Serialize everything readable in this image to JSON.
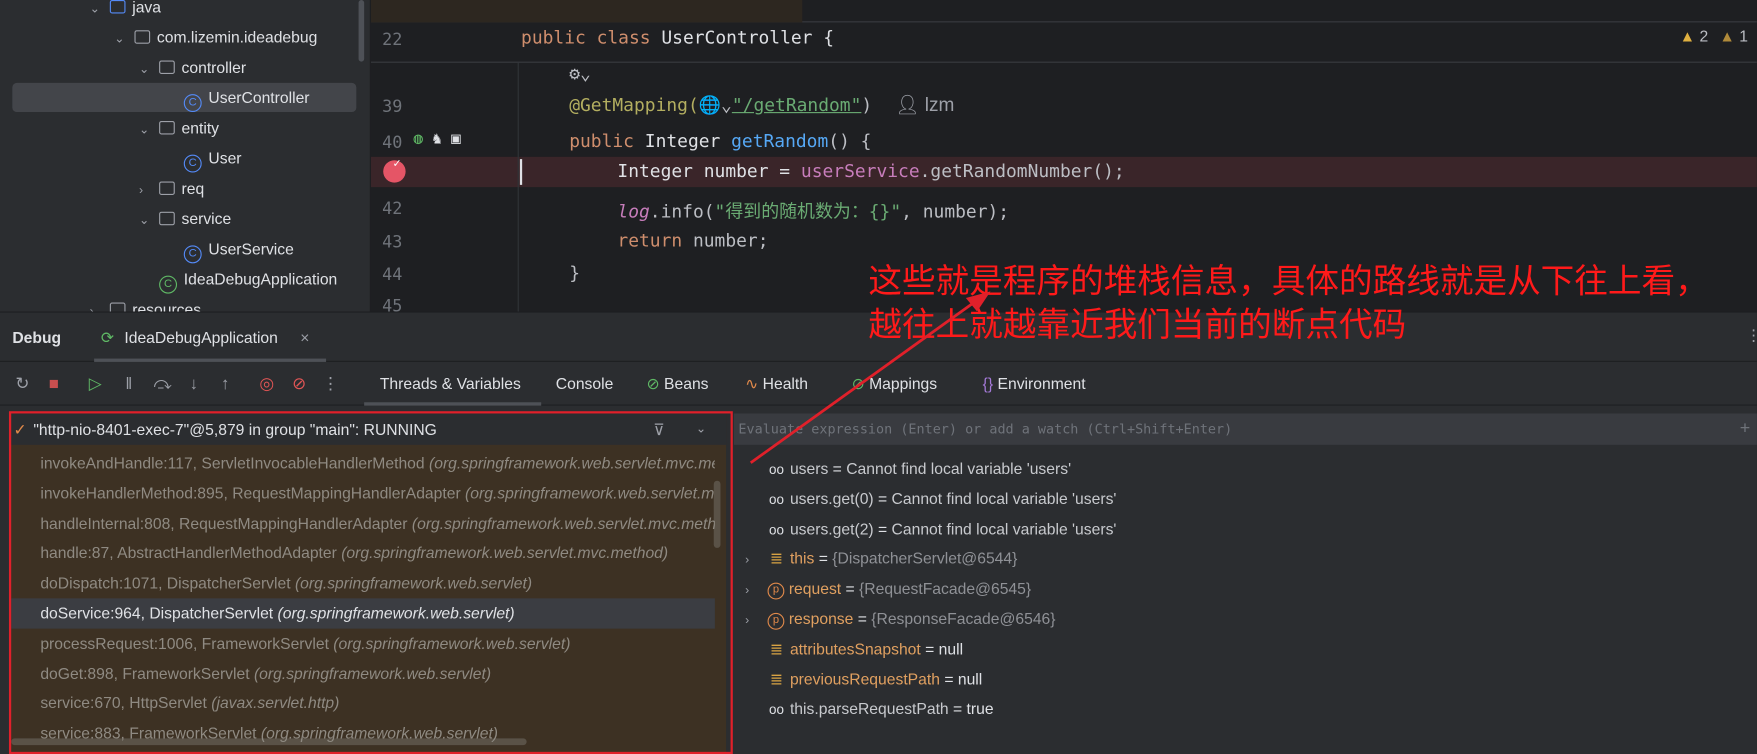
{
  "project_tree": [
    {
      "label": "java",
      "depth": 0,
      "icon": "folder-source",
      "chev": "down"
    },
    {
      "label": "com.lizemin.ideadebug",
      "depth": 1,
      "icon": "package",
      "chev": "down"
    },
    {
      "label": "controller",
      "depth": 2,
      "icon": "package",
      "chev": "down"
    },
    {
      "label": "UserController",
      "depth": 3,
      "icon": "class",
      "chev": "",
      "selected": true
    },
    {
      "label": "entity",
      "depth": 2,
      "icon": "package",
      "chev": "down"
    },
    {
      "label": "User",
      "depth": 3,
      "icon": "class",
      "chev": ""
    },
    {
      "label": "req",
      "depth": 2,
      "icon": "package",
      "chev": "right"
    },
    {
      "label": "service",
      "depth": 2,
      "icon": "package",
      "chev": "down"
    },
    {
      "label": "UserService",
      "depth": 3,
      "icon": "class",
      "chev": ""
    },
    {
      "label": "IdeaDebugApplication",
      "depth": 2,
      "icon": "spring-boot-app",
      "chev": ""
    },
    {
      "label": "resources",
      "depth": 0,
      "icon": "folder",
      "chev": "right"
    }
  ],
  "editor": {
    "warnings": {
      "warn_count": "2",
      "weak_warn_count": "1"
    },
    "author": "lzm",
    "lines": [
      {
        "num": "22",
        "indent": 0,
        "tokens": [
          [
            "public class ",
            "kw"
          ],
          [
            "UserController {",
            "ty"
          ]
        ]
      },
      {
        "num": "",
        "indent": 1,
        "tokens": [
          [
            "⚙⌄",
            "pl"
          ]
        ]
      },
      {
        "num": "39",
        "indent": 1,
        "tokens": [
          [
            "@GetMapping(",
            "an"
          ],
          [
            "🌐⌄",
            "pl"
          ],
          [
            "\"/getRandom\"",
            "st ul"
          ],
          [
            ")",
            "pl"
          ]
        ]
      },
      {
        "num": "40",
        "indent": 1,
        "tokens": [
          [
            "public ",
            "kw"
          ],
          [
            "Integer ",
            "ty"
          ],
          [
            "getRandom",
            "fn"
          ],
          [
            "() {",
            "pl"
          ]
        ]
      },
      {
        "num": "",
        "indent": 2,
        "tokens": [
          [
            "Integer number = ",
            "ty"
          ],
          [
            "userService",
            "fd"
          ],
          [
            ".getRandomNumber();",
            "pl"
          ]
        ],
        "breakpoint": true
      },
      {
        "num": "42",
        "indent": 2,
        "tokens": [
          [
            "log",
            "lg"
          ],
          [
            ".info(",
            "pl"
          ],
          [
            "\"得到的随机数为：{}\"",
            "st"
          ],
          [
            ", number);",
            "pl"
          ]
        ]
      },
      {
        "num": "43",
        "indent": 2,
        "tokens": [
          [
            "return ",
            "kw"
          ],
          [
            "number;",
            "pl"
          ]
        ]
      },
      {
        "num": "44",
        "indent": 1,
        "tokens": [
          [
            "}",
            "pl"
          ]
        ]
      },
      {
        "num": "45",
        "indent": 0,
        "tokens": []
      }
    ]
  },
  "annotation": {
    "line1": "这些就是程序的堆栈信息，具体的路线就是从下往上看，",
    "line2": "越往上就越靠近我们当前的断点代码",
    "color": "#ff1a1a"
  },
  "debug": {
    "title": "Debug",
    "session_tab": "IdeaDebugApplication",
    "toolbar": [
      "rerun-icon",
      "stop-icon",
      "resume-icon",
      "pause-icon",
      "step-over-icon",
      "step-into-icon",
      "step-out-icon",
      "view-breakpoints-icon",
      "mute-breakpoints-icon",
      "more-icon"
    ],
    "tabs": [
      {
        "label": "Threads & Variables",
        "icon": "",
        "active": true
      },
      {
        "label": "Console",
        "icon": ""
      },
      {
        "label": "Beans",
        "icon": "beans-icon"
      },
      {
        "label": "Health",
        "icon": "health-icon"
      },
      {
        "label": "Mappings",
        "icon": "mappings-icon"
      },
      {
        "label": "Environment",
        "icon": "environment-icon"
      }
    ],
    "thread": "\"http-nio-8401-exec-7\"@5,879 in group \"main\": RUNNING",
    "frames": [
      {
        "method": "invokeAndHandle:117, ServletInvocableHandlerMethod",
        "pkg": "(org.springframework.web.servlet.mvc.method.annotation)"
      },
      {
        "method": "invokeHandlerMethod:895, RequestMappingHandlerAdapter",
        "pkg": "(org.springframework.web.servlet.mvc.method.annotation)"
      },
      {
        "method": "handleInternal:808, RequestMappingHandlerAdapter",
        "pkg": "(org.springframework.web.servlet.mvc.method.annotation)"
      },
      {
        "method": "handle:87, AbstractHandlerMethodAdapter",
        "pkg": "(org.springframework.web.servlet.mvc.method)"
      },
      {
        "method": "doDispatch:1071, DispatcherServlet",
        "pkg": "(org.springframework.web.servlet)"
      },
      {
        "method": "doService:964, DispatcherServlet",
        "pkg": "(org.springframework.web.servlet)",
        "selected": true
      },
      {
        "method": "processRequest:1006, FrameworkServlet",
        "pkg": "(org.springframework.web.servlet)"
      },
      {
        "method": "doGet:898, FrameworkServlet",
        "pkg": "(org.springframework.web.servlet)"
      },
      {
        "method": "service:670, HttpServlet",
        "pkg": "(javax.servlet.http)"
      },
      {
        "method": "service:883, FrameworkServlet",
        "pkg": "(org.springframework.web.servlet)"
      }
    ],
    "evaluate_placeholder": "Evaluate expression (Enter) or add a watch (Ctrl+Shift+Enter)",
    "variables": [
      {
        "kind": "watch",
        "expand": false,
        "name": "users",
        "value": "Cannot find local variable 'users'"
      },
      {
        "kind": "watch",
        "expand": false,
        "name": "users.get(0)",
        "value": "Cannot find local variable 'users'"
      },
      {
        "kind": "watch",
        "expand": false,
        "name": "users.get(2)",
        "value": "Cannot find local variable 'users'"
      },
      {
        "kind": "field",
        "expand": true,
        "name": "this",
        "value": "{DispatcherServlet@6544}",
        "valstyle": "g"
      },
      {
        "kind": "param",
        "expand": true,
        "name": "request",
        "value": "{RequestFacade@6545}",
        "valstyle": "g"
      },
      {
        "kind": "param",
        "expand": true,
        "name": "response",
        "value": "{ResponseFacade@6546}",
        "valstyle": "g"
      },
      {
        "kind": "field",
        "expand": false,
        "name": "attributesSnapshot",
        "value": "null",
        "valstyle": "w"
      },
      {
        "kind": "field",
        "expand": false,
        "name": "previousRequestPath",
        "value": "null",
        "valstyle": "w"
      },
      {
        "kind": "watch",
        "expand": false,
        "name": "this.parseRequestPath",
        "value": "true",
        "valstyle": "w"
      }
    ]
  }
}
